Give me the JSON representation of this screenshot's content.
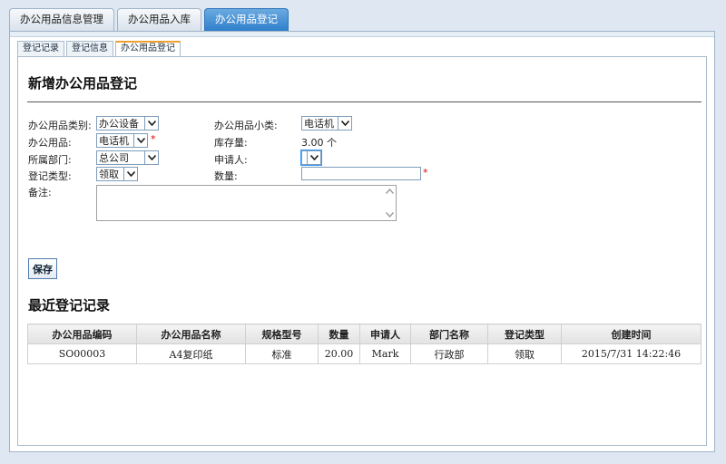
{
  "top_tabs": [
    {
      "label": "办公用品信息管理"
    },
    {
      "label": "办公用品入库"
    },
    {
      "label": "办公用品登记"
    }
  ],
  "sub_tabs": [
    {
      "label": "登记记录"
    },
    {
      "label": "登记信息"
    },
    {
      "label": "办公用品登记"
    }
  ],
  "form": {
    "title": "新增办公用品登记",
    "category_label": "办公用品类别:",
    "category_value": "办公设备",
    "subcategory_label": "办公用品小类:",
    "subcategory_value": "电话机",
    "item_label": "办公用品:",
    "item_value": "电话机",
    "required_mark": "*",
    "stock_label": "库存量:",
    "stock_value": "3.00 个",
    "department_label": "所属部门:",
    "department_value": "总公司",
    "applicant_label": "申请人:",
    "applicant_value": "",
    "type_label": "登记类型:",
    "type_value": "领取",
    "quantity_label": "数量:",
    "quantity_value": "",
    "remark_label": "备注:",
    "remark_value": "",
    "save_label": "保存"
  },
  "records": {
    "title": "最近登记记录",
    "columns": [
      "办公用品编码",
      "办公用品名称",
      "规格型号",
      "数量",
      "申请人",
      "部门名称",
      "登记类型",
      "创建时间"
    ],
    "rows": [
      [
        "SO00003",
        "A4复印纸",
        "标准",
        "20.00",
        "Mark",
        "行政部",
        "领取",
        "2015/7/31 14:22:46"
      ]
    ]
  },
  "icons": {
    "dropdown": "chevron-down-icon",
    "scroll_up": "scroll-up-icon",
    "scroll_down": "scroll-down-icon"
  },
  "colors": {
    "active_tab": "#2f7fcc",
    "required": "#dd0000",
    "background": "#dfe8f2"
  }
}
